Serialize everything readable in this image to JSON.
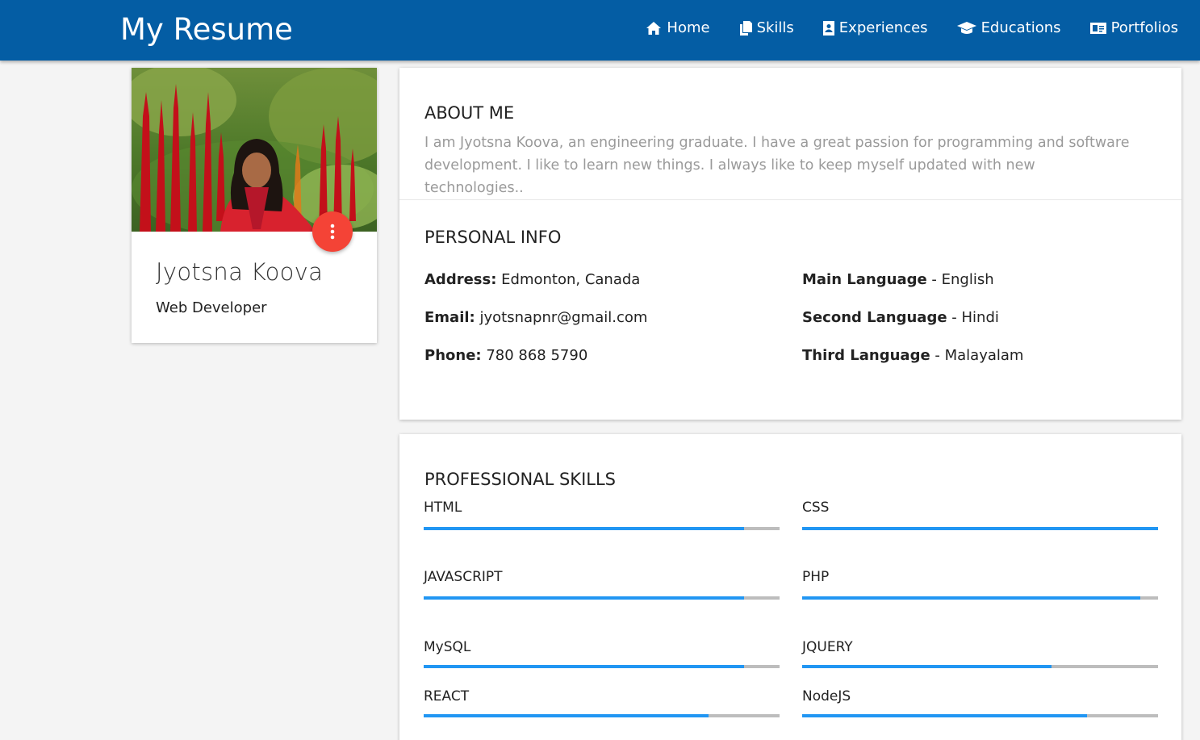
{
  "header": {
    "brand": "My Resume",
    "nav": [
      {
        "label": "Home",
        "icon": "home-icon"
      },
      {
        "label": "Skills",
        "icon": "copy-icon"
      },
      {
        "label": "Experiences",
        "icon": "contact-card-icon"
      },
      {
        "label": "Educations",
        "icon": "graduation-cap-icon"
      },
      {
        "label": "Portfolios",
        "icon": "id-card-icon"
      }
    ]
  },
  "profile": {
    "name": "Jyotsna Koova",
    "title": "Web Developer"
  },
  "about": {
    "heading": "ABOUT ME",
    "text": "I am Jyotsna Koova, an engineering graduate. I have a great passion for programming and software development. I like to learn new things. I always like to keep myself updated with new technologies.."
  },
  "personal_info": {
    "heading": "PERSONAL INFO",
    "address_label": "Address:",
    "address_value": "Edmonton, Canada",
    "email_label": "Email:",
    "email_value": "jyotsnapnr@gmail.com",
    "phone_label": "Phone:",
    "phone_value": "780 868 5790",
    "main_language_label": "Main Language",
    "main_language_value": "- English",
    "second_language_label": "Second Language",
    "second_language_value": "- Hindi",
    "third_language_label": "Third Language",
    "third_language_value": "- Malayalam"
  },
  "skills": {
    "heading": "PROFESSIONAL SKILLS",
    "items": [
      {
        "name": "HTML",
        "level": 0.9
      },
      {
        "name": "CSS",
        "level": 1.0
      },
      {
        "name": "JAVASCRIPT",
        "level": 0.9
      },
      {
        "name": "PHP",
        "level": 0.95
      },
      {
        "name": "MySQL",
        "level": 0.9
      },
      {
        "name": "JQUERY",
        "level": 0.7
      },
      {
        "name": "REACT",
        "level": 0.8
      },
      {
        "name": "NodeJS",
        "level": 0.8
      }
    ]
  },
  "colors": {
    "navbar": "#045da4",
    "fab": "#f44336",
    "skill_fill": "#2196f3",
    "skill_track": "#bdbdbd"
  }
}
